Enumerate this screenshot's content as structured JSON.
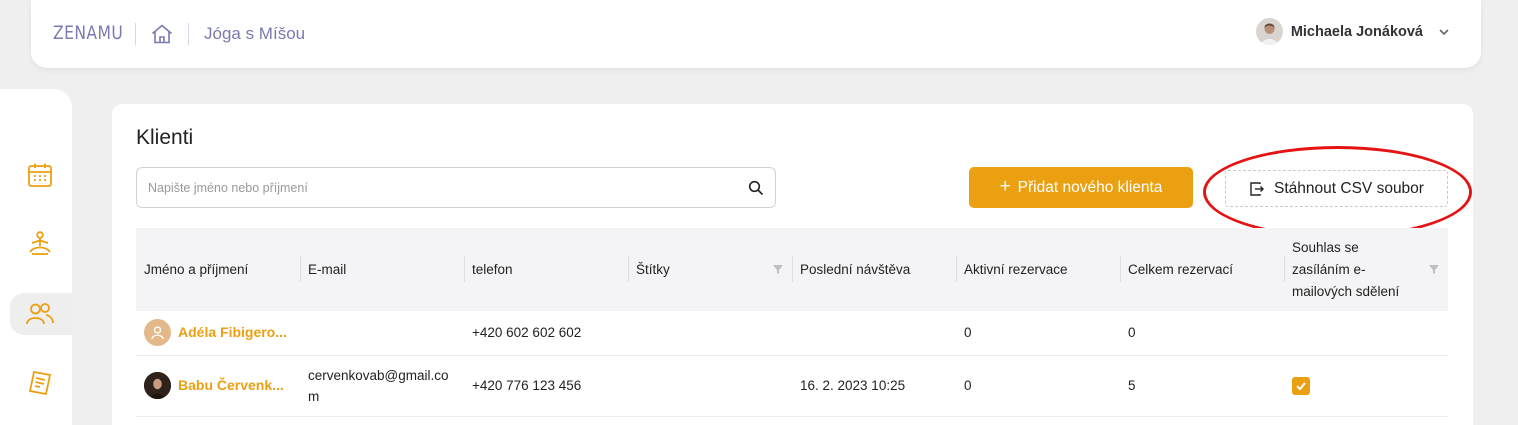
{
  "header": {
    "logo": "ZENAMU",
    "breadcrumb": "Jóga s Míšou",
    "user_name": "Michaela Jonáková"
  },
  "sidebar": {
    "items": [
      {
        "icon": "calendar-icon",
        "active": false
      },
      {
        "icon": "yoga-icon",
        "active": false
      },
      {
        "icon": "clients-icon",
        "active": true
      },
      {
        "icon": "receipt-icon",
        "active": false
      }
    ]
  },
  "page": {
    "title": "Klienti",
    "search_placeholder": "Napište jméno nebo příjmení",
    "add_button": "Přidat nového klienta",
    "csv_button": "Stáhnout CSV soubor"
  },
  "table": {
    "columns": [
      "Jméno a příjmení",
      "E-mail",
      "telefon",
      "Štítky",
      "Poslední návštěva",
      "Aktivní rezervace",
      "Celkem rezervací",
      "Souhlas se zasíláním e-mailových sdělení"
    ],
    "rows": [
      {
        "name": "Adéla Fibigero...",
        "email": "",
        "phone": "+420 602 602 602",
        "tags": "",
        "last_visit": "",
        "active": "0",
        "total": "0",
        "consent": false
      },
      {
        "name": "Babu Červenk...",
        "email": "cervenkovab@gmail.com",
        "phone": "+420 776 123 456",
        "tags": "",
        "last_visit": "16. 2. 2023 10:25",
        "active": "0",
        "total": "5",
        "consent": true
      }
    ]
  },
  "colors": {
    "accent": "#eba011",
    "brand": "#7a7ab0",
    "annotation": "#e41414"
  }
}
